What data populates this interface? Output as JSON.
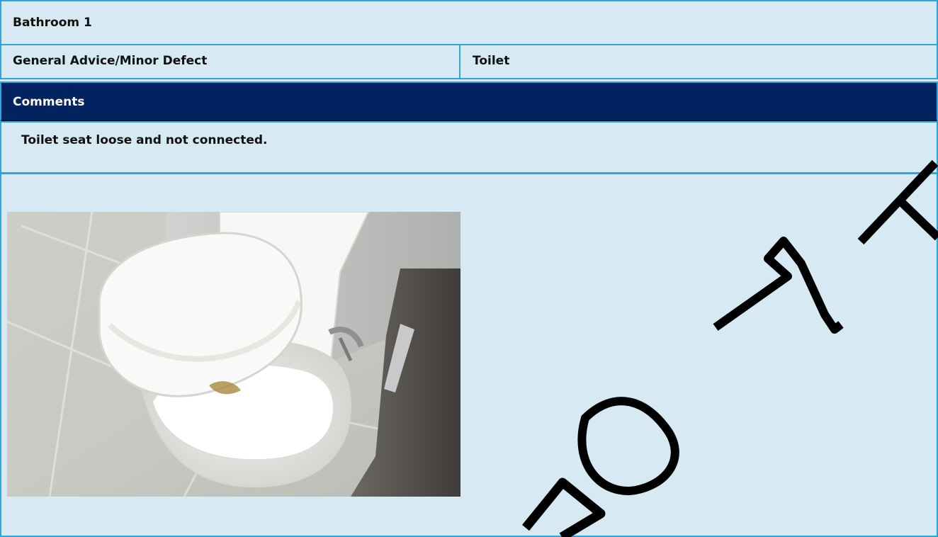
{
  "section": {
    "title": "Bathroom 1"
  },
  "defect": {
    "category": "General Advice/Minor Defect",
    "item": "Toilet"
  },
  "comments": {
    "header": "Comments",
    "body": "Toilet seat loose and not connected."
  },
  "photo": {
    "subject": "toilet-with-loose-seat"
  },
  "watermark": {
    "text": "REPORT",
    "visible_letters": "PORT",
    "color": "#000000"
  },
  "colors": {
    "table_background": "#d7e9f2",
    "border": "#2aa6dd",
    "header_background": "#02235f",
    "header_text": "#ffffff",
    "body_text": "#111111"
  }
}
